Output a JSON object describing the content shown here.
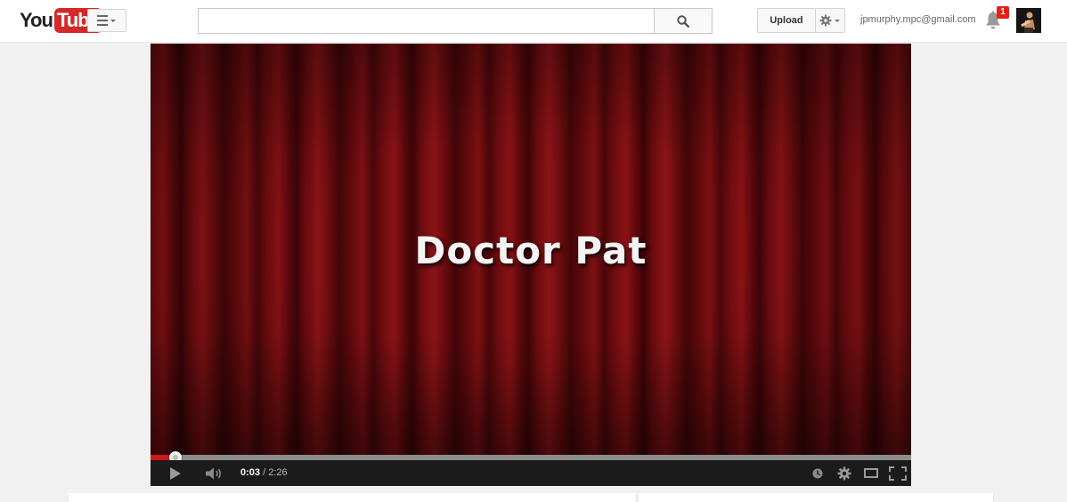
{
  "masthead": {
    "logo": {
      "you": "You",
      "tube": "Tube"
    },
    "search": {
      "placeholder": "",
      "value": ""
    },
    "upload_label": "Upload",
    "account_email": "jpmurphy.mpc@gmail.com",
    "notification_count": "1",
    "icons": {
      "guide": "menu-icon",
      "search": "search-icon",
      "settings": "gear-icon",
      "notifications": "bell-icon"
    }
  },
  "player": {
    "video_title_text": "Doctor Pat",
    "time_current": "0:03",
    "time_separator": " / ",
    "time_total": "2:26",
    "progress_fraction": 0.0329,
    "colors": {
      "played": "#cc181e",
      "curtain": "#7a0f12"
    },
    "icons": {
      "play": "play-icon",
      "volume": "volume-icon",
      "watch_later": "clock-icon",
      "settings": "gear-icon",
      "size": "theater-mode-icon",
      "fullscreen": "fullscreen-icon"
    }
  }
}
